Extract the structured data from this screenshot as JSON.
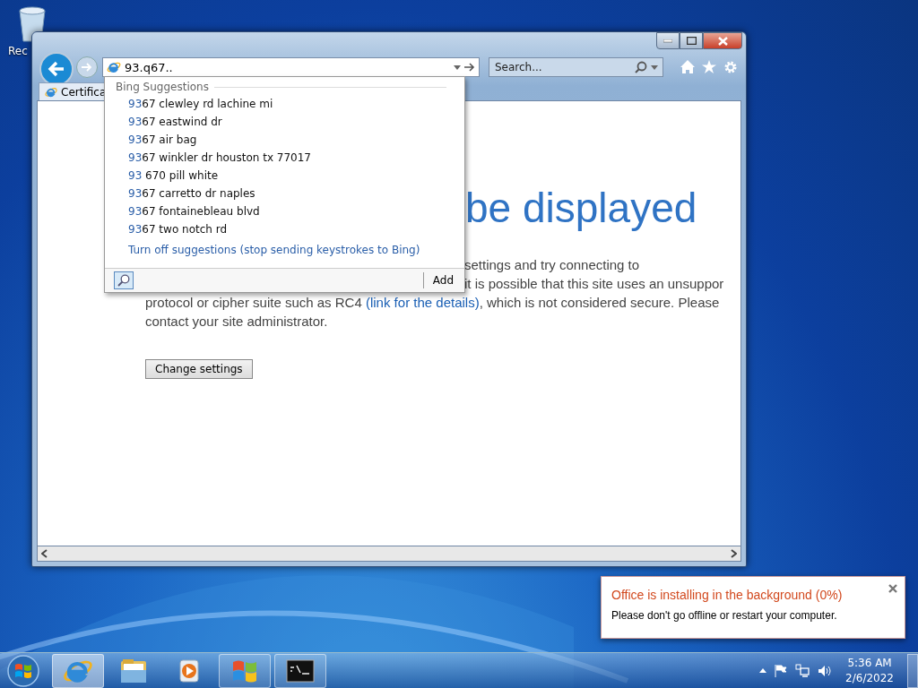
{
  "desktop": {
    "icons": [
      {
        "label": "Rec"
      }
    ]
  },
  "browser": {
    "address": {
      "value": "93.q67.."
    },
    "search": {
      "placeholder": "Search..."
    },
    "tabs": [
      {
        "label": "Certifica",
        "selected": true
      }
    ],
    "page": {
      "heading": "be displayed",
      "fragments": [
        "settings and try connecting to",
        "it is possible that this site uses an unsuppor"
      ],
      "lines": [
        {
          "before": "protocol or cipher suite such as RC4 ",
          "link": "(link for the details)",
          "after": ", which is not considered secure. Please"
        },
        {
          "before": "contact your site administrator."
        }
      ],
      "button": "Change settings"
    },
    "suggestions": {
      "header": "Bing Suggestions",
      "items": [
        {
          "match": "93",
          "rest": "67 clewley rd lachine mi"
        },
        {
          "match": "93",
          "rest": "67 eastwind dr"
        },
        {
          "match": "93",
          "rest": "67 air bag"
        },
        {
          "match": "93",
          "rest": "67 winkler dr houston tx 77017"
        },
        {
          "match": "93",
          "rest": " 670 pill white"
        },
        {
          "match": "93",
          "rest": "67 carretto dr naples"
        },
        {
          "match": "93",
          "rest": "67 fontainebleau blvd"
        },
        {
          "match": "93",
          "rest": "67 two notch rd"
        }
      ],
      "turn_off": "Turn off suggestions (stop sending keystrokes to Bing)",
      "add_button": "Add"
    }
  },
  "notification": {
    "title": "Office is installing in the background (0%)",
    "body": "Please don't go offline or restart your computer."
  },
  "taskbar": {
    "items": [
      {
        "kind": "ie",
        "running": true,
        "selected": true
      },
      {
        "kind": "explorer",
        "running": false,
        "selected": false
      },
      {
        "kind": "media",
        "running": false,
        "selected": false
      },
      {
        "kind": "windows",
        "running": true,
        "selected": false
      },
      {
        "kind": "cmd",
        "running": true,
        "selected": false
      }
    ],
    "clock": {
      "time": "5:36 AM",
      "date": "2/6/2022"
    }
  }
}
